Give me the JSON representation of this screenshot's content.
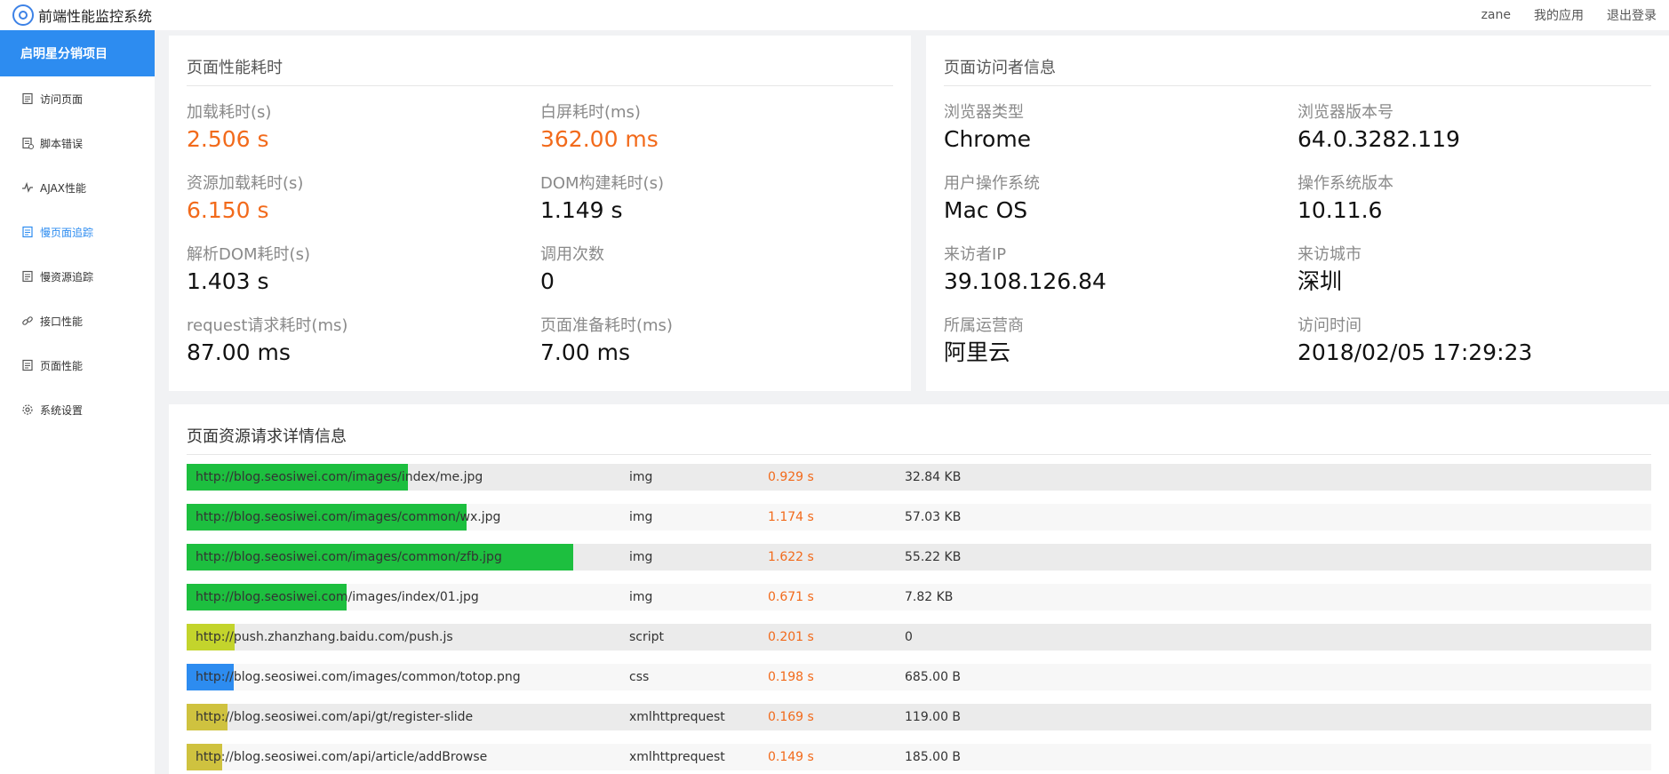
{
  "app": {
    "title": "前端性能监控系统",
    "links": [
      "zane",
      "我的应用",
      "退出登录"
    ]
  },
  "sidebar": {
    "project": "启明星分销项目",
    "items": [
      {
        "label": "访问页面",
        "icon": "document-icon",
        "active": false
      },
      {
        "label": "脚本错误",
        "icon": "script-error-icon",
        "active": false
      },
      {
        "label": "AJAX性能",
        "icon": "pulse-icon",
        "active": false
      },
      {
        "label": "慢页面追踪",
        "icon": "page-trace-icon",
        "active": true
      },
      {
        "label": "慢资源追踪",
        "icon": "document-icon",
        "active": false
      },
      {
        "label": "接口性能",
        "icon": "link-icon",
        "active": false
      },
      {
        "label": "页面性能",
        "icon": "document-icon",
        "active": false
      },
      {
        "label": "系统设置",
        "icon": "gear-icon",
        "active": false
      }
    ]
  },
  "perf": {
    "title": "页面性能耗时",
    "items": [
      {
        "label": "加载耗时(s)",
        "value": "2.506 s",
        "highlight": true
      },
      {
        "label": "白屏耗时(ms)",
        "value": "362.00 ms",
        "highlight": true
      },
      {
        "label": "资源加载耗时(s)",
        "value": "6.150 s",
        "highlight": true
      },
      {
        "label": "DOM构建耗时(s)",
        "value": "1.149 s",
        "highlight": false
      },
      {
        "label": "解析DOM耗时(s)",
        "value": "1.403 s",
        "highlight": false
      },
      {
        "label": "调用次数",
        "value": "0",
        "highlight": false
      },
      {
        "label": "request请求耗时(ms)",
        "value": "87.00 ms",
        "highlight": false
      },
      {
        "label": "页面准备耗时(ms)",
        "value": "7.00 ms",
        "highlight": false
      }
    ]
  },
  "visitor": {
    "title": "页面访问者信息",
    "items": [
      {
        "label": "浏览器类型",
        "value": "Chrome"
      },
      {
        "label": "浏览器版本号",
        "value": "64.0.3282.119"
      },
      {
        "label": "用户操作系统",
        "value": "Mac OS"
      },
      {
        "label": "操作系统版本",
        "value": "10.11.6"
      },
      {
        "label": "来访者IP",
        "value": "39.108.126.84"
      },
      {
        "label": "来访城市",
        "value": "深圳"
      },
      {
        "label": "所属运营商",
        "value": "阿里云"
      },
      {
        "label": "访问时间",
        "value": "2018/02/05 17:29:23"
      }
    ]
  },
  "resources": {
    "title": "页面资源请求详情信息",
    "colors": {
      "img": "#1dbf3f",
      "script": "#c3d42c",
      "css": "#2d8cf0",
      "xmlhttprequest": "#cfc23f"
    },
    "rows": [
      {
        "url": "http://blog.seosiwei.com/images/index/me.jpg",
        "type": "img",
        "time": "0.929 s",
        "size": "32.84 KB",
        "fraction": 0.151
      },
      {
        "url": "http://blog.seosiwei.com/images/common/wx.jpg",
        "type": "img",
        "time": "1.174 s",
        "size": "57.03 KB",
        "fraction": 0.191
      },
      {
        "url": "http://blog.seosiwei.com/images/common/zfb.jpg",
        "type": "img",
        "time": "1.622 s",
        "size": "55.22 KB",
        "fraction": 0.264
      },
      {
        "url": "http://blog.seosiwei.com/images/index/01.jpg",
        "type": "img",
        "time": "0.671 s",
        "size": "7.82 KB",
        "fraction": 0.109
      },
      {
        "url": "http://push.zhanzhang.baidu.com/push.js",
        "type": "script",
        "time": "0.201 s",
        "size": "0",
        "fraction": 0.033
      },
      {
        "url": "http://blog.seosiwei.com/images/common/totop.png",
        "type": "css",
        "time": "0.198 s",
        "size": "685.00 B",
        "fraction": 0.032
      },
      {
        "url": "http://blog.seosiwei.com/api/gt/register-slide",
        "type": "xmlhttprequest",
        "time": "0.169 s",
        "size": "119.00 B",
        "fraction": 0.028
      },
      {
        "url": "http://blog.seosiwei.com/api/article/addBrowse",
        "type": "xmlhttprequest",
        "time": "0.149 s",
        "size": "185.00 B",
        "fraction": 0.024
      }
    ]
  }
}
